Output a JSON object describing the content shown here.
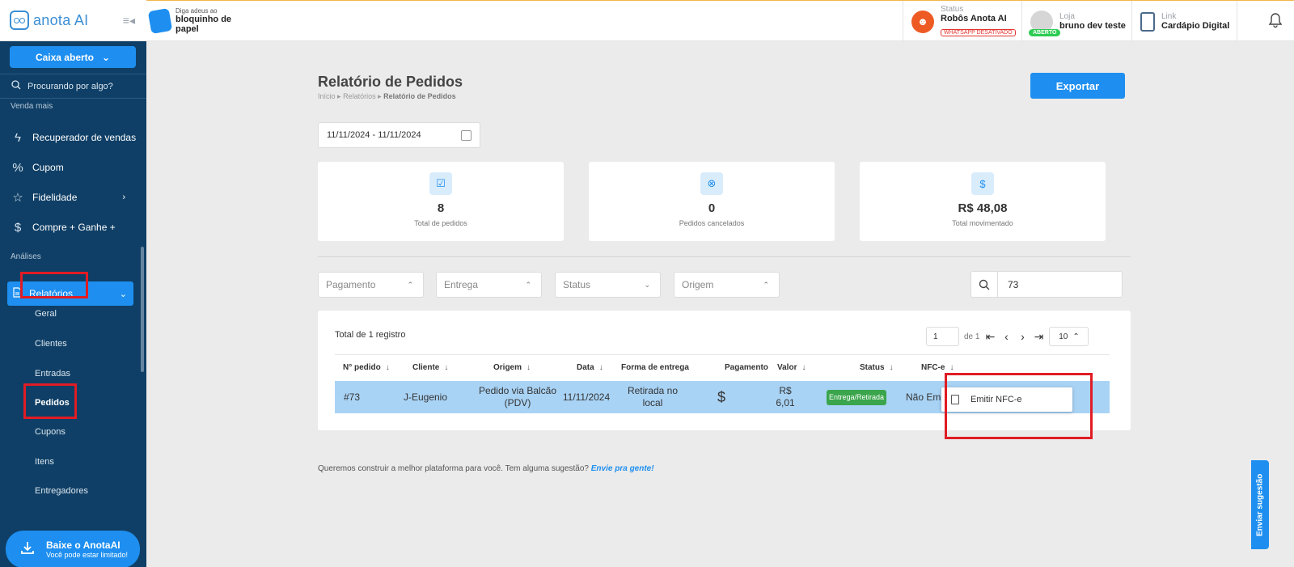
{
  "app": {
    "logo_text": "anota AI"
  },
  "sidebar": {
    "caixa_label": "Caixa aberto",
    "search_placeholder": "Procurando por algo?",
    "section_venda": "Venda mais",
    "items": [
      {
        "label": "Recuperador de vendas",
        "icon": "lightning-icon"
      },
      {
        "label": "Cupom",
        "icon": "percent-icon"
      },
      {
        "label": "Fidelidade",
        "icon": "star-icon"
      },
      {
        "label": "Compre + Ganhe +",
        "icon": "dollar-icon"
      }
    ],
    "section_analises": "Análises",
    "relatorios_label": "Relatórios",
    "sub_items": [
      "Geral",
      "Clientes",
      "Entradas",
      "Pedidos",
      "Cupons",
      "Itens",
      "Entregadores"
    ],
    "download_title": "Baixe o AnotaAI",
    "download_subtitle": "Você pode estar limitado!"
  },
  "topbar": {
    "promo_line1": "Diga adeus ao",
    "promo_line2": "bloquinho de",
    "promo_line3": "papel",
    "status_label": "Status",
    "status_value": "Robôs Anota AI",
    "whatsapp_badge": "WHATSAPP DESATIVADO",
    "loja_label": "Loja",
    "loja_value": "bruno dev teste",
    "aberto_badge": "ABERTO",
    "link_label": "Link",
    "link_value": "Cardápio Digital"
  },
  "page": {
    "title": "Relatório de Pedidos",
    "breadcrumb_1": "Início",
    "breadcrumb_2": "Relatórios",
    "breadcrumb_3": "Relatório de Pedidos",
    "export_label": "Exportar",
    "date_range": "11/11/2024 - 11/11/2024"
  },
  "stats": [
    {
      "value": "8",
      "label": "Total de pedidos",
      "icon": "checkbox-icon"
    },
    {
      "value": "0",
      "label": "Pedidos cancelados",
      "icon": "cancel-circle-icon"
    },
    {
      "value": "R$ 48,08",
      "label": "Total movimentado",
      "icon": "dollar-icon"
    }
  ],
  "filters": [
    {
      "placeholder": "Pagamento"
    },
    {
      "placeholder": "Entrega"
    },
    {
      "placeholder": "Status"
    },
    {
      "placeholder": "Origem"
    }
  ],
  "search": {
    "value": "73"
  },
  "table": {
    "total_label": "Total de 1 registro",
    "page_input": "1",
    "page_of": "de 1",
    "page_size": "10",
    "headers": [
      "N° pedido",
      "Cliente",
      "Origem",
      "Data",
      "Forma de entrega",
      "Pagamento",
      "Valor",
      "Status",
      "NFC-e"
    ],
    "row": {
      "pedido": "#73",
      "cliente": "J-Eugenio",
      "origem": "Pedido via Balcão (PDV)",
      "data": "11/11/2024",
      "entrega": "Retirada no local",
      "pagamento_icon": "$",
      "valor": "R$ 6,01",
      "status": "Entrega/Retirada",
      "nfce": "Não Emitido"
    },
    "popup_label": "Emitir NFC-e"
  },
  "footer": {
    "text": "Queremos construir a melhor plataforma para você. Tem alguma sugestão?",
    "link": "Envie pra gente!",
    "feedback_tab": "Enviar sugestão"
  }
}
